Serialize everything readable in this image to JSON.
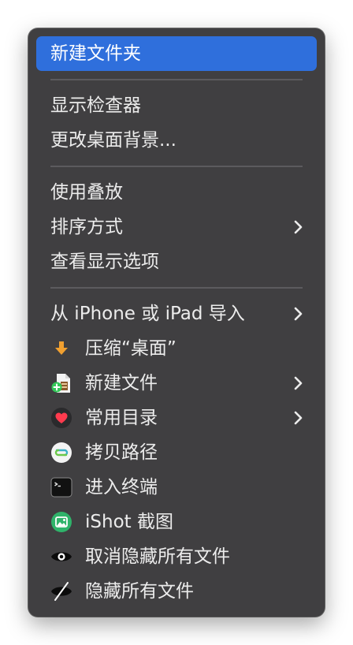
{
  "menu": {
    "items": [
      {
        "label": "新建文件夹",
        "highlighted": true
      },
      {
        "label": "显示检查器"
      },
      {
        "label": "更改桌面背景..."
      },
      {
        "label": "使用叠放"
      },
      {
        "label": "排序方式",
        "submenu": true
      },
      {
        "label": "查看显示选项"
      },
      {
        "label": "从 iPhone 或 iPad 导入",
        "submenu": true
      },
      {
        "label": "压缩“桌面”",
        "icon": "compress-arrow-icon"
      },
      {
        "label": "新建文件",
        "icon": "new-file-icon",
        "submenu": true
      },
      {
        "label": "常用目录",
        "icon": "heart-icon",
        "submenu": true
      },
      {
        "label": "拷贝路径",
        "icon": "copy-path-icon"
      },
      {
        "label": "进入终端",
        "icon": "terminal-icon"
      },
      {
        "label": "iShot 截图",
        "icon": "ishot-icon"
      },
      {
        "label": "取消隐藏所有文件",
        "icon": "eye-icon"
      },
      {
        "label": "隐藏所有文件",
        "icon": "eye-slash-icon"
      }
    ]
  },
  "colors": {
    "menu_background": "#403f41",
    "highlight": "#2f6fdc",
    "text": "#ececec",
    "separator": "#5c5b5e"
  }
}
